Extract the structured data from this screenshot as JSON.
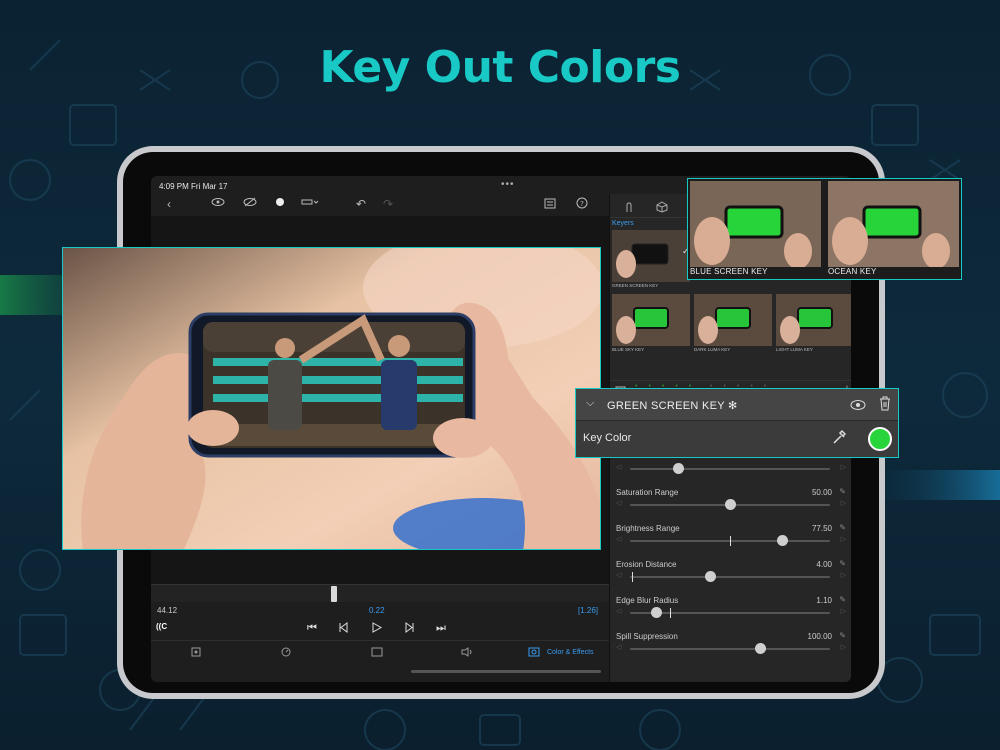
{
  "headline": "Key Out Colors",
  "status": {
    "time": "4:09 PM  Fri Mar 17",
    "multitask": "•••"
  },
  "transport": {
    "timecode_current": "44.12",
    "timecode_selection": "0.22",
    "timecode_total": "[1.26]",
    "cc_badge": "((C"
  },
  "bottom_bar": {
    "color_effects_label": "Color & Effects"
  },
  "keyers": {
    "section_label": "Keyers",
    "items": [
      {
        "label": "GREEN SCREEN KEY"
      },
      {
        "label": "BLUE SKY KEY"
      },
      {
        "label": "DARK LUMA KEY"
      },
      {
        "label": "LIGHT LUMA KEY"
      }
    ]
  },
  "key_popup": {
    "title": "GREEN SCREEN KEY ✻",
    "key_color_label": "Key Color",
    "key_color": "#27d53a"
  },
  "keys_popup": {
    "items": [
      {
        "label": "BLUE SCREEN KEY"
      },
      {
        "label": "OCEAN KEY"
      }
    ]
  },
  "parameters": [
    {
      "label": "Saturation Range",
      "value": "50.00",
      "level": 0.5
    },
    {
      "label": "Brightness Range",
      "value": "77.50",
      "level": 0.76
    },
    {
      "label": "Erosion Distance",
      "value": "4.00",
      "level": 0.4
    },
    {
      "label": "Edge Blur Radius",
      "value": "1.10",
      "level": 0.13
    },
    {
      "label": "Spill Suppression",
      "value": "100.00",
      "level": 0.65
    }
  ],
  "top_slider_level": 0.24,
  "colors": {
    "accent": "#19c9c5",
    "link": "#3a9cf0",
    "background": "#0c2433"
  }
}
